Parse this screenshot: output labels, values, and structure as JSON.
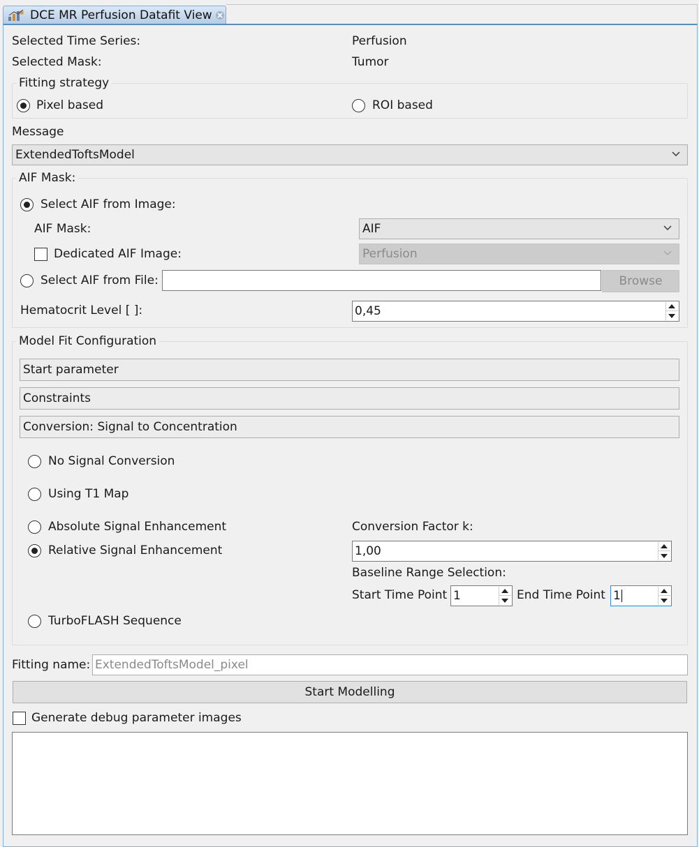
{
  "tab": {
    "title": "DCE MR Perfusion Datafit View"
  },
  "selection": {
    "time_series_label": "Selected Time Series:",
    "time_series_value": "Perfusion",
    "mask_label": "Selected Mask:",
    "mask_value": "Tumor"
  },
  "fitting_strategy": {
    "title": "Fitting strategy",
    "pixel_label": "Pixel based",
    "roi_label": "ROI based",
    "selected": "pixel"
  },
  "message": {
    "label": "Message",
    "model_value": "ExtendedToftsModel"
  },
  "aif": {
    "title": "AIF Mask:",
    "select_from_image_label": "Select AIF from Image:",
    "mask_label": "AIF Mask:",
    "mask_value": "AIF",
    "dedicated_label": "Dedicated AIF Image:",
    "dedicated_value": "Perfusion",
    "select_from_file_label": "Select AIF from File:",
    "file_value": "",
    "browse_label": "Browse",
    "hematocrit_label": "Hematocrit Level [  ]:",
    "hematocrit_value": "0,45"
  },
  "model_fit": {
    "title": "Model Fit Configuration",
    "start_parameter": "Start parameter",
    "constraints": "Constraints",
    "conversion": "Conversion: Signal to Concentration",
    "options": {
      "no_conversion": "No Signal Conversion",
      "t1_map": "Using T1 Map",
      "absolute": "Absolute Signal Enhancement",
      "relative": "Relative Signal Enhancement",
      "turboflash": "TurboFLASH Sequence"
    },
    "selected": "relative",
    "conversion_factor_label": "Conversion Factor k:",
    "conversion_factor_value": "1,00",
    "baseline_label": "Baseline Range Selection:",
    "start_time_label": "Start Time Point",
    "start_time_value": "1",
    "end_time_label": "End Time Point",
    "end_time_value": "1"
  },
  "fitting_name": {
    "label": "Fitting name:",
    "value": "ExtendedToftsModel_pixel"
  },
  "start_button": "Start Modelling",
  "debug_label": "Generate debug parameter images",
  "log_text": "",
  "colors": {
    "tab_gradient_top": "#dbe8f5",
    "tab_gradient_bottom": "#b6cde6",
    "panel_border": "#4a90cf",
    "background": "#f0f0f0"
  }
}
